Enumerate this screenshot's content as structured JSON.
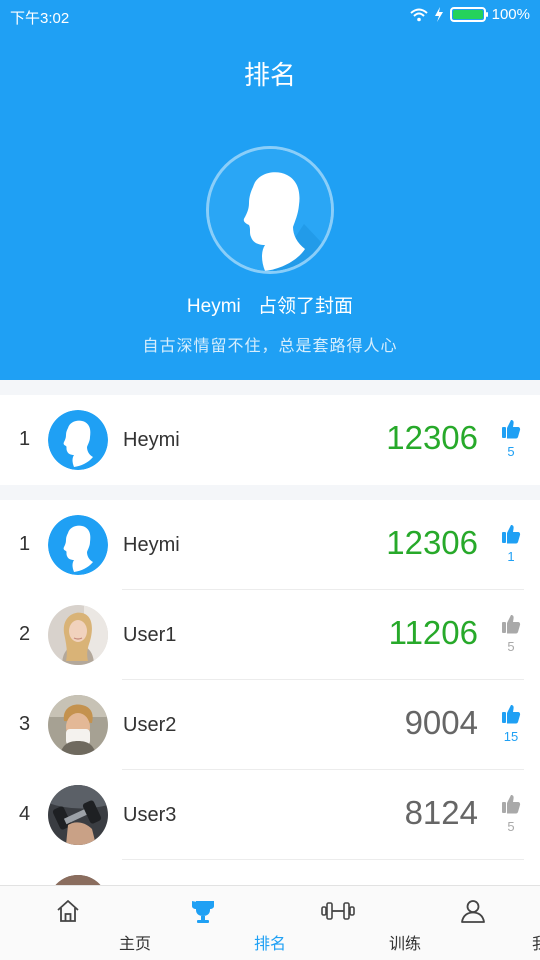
{
  "status_bar": {
    "time": "下午3:02",
    "battery": "100%",
    "battery_level": 1.0
  },
  "header": {
    "title": "排名",
    "cover_user": "Heymi",
    "cover_text": "占领了封面",
    "subtitle": "自古深情留不住，总是套路得人心"
  },
  "my_rank": {
    "rank": "1",
    "name": "Heymi",
    "score": "12306",
    "likes": "5",
    "liked": true,
    "avatar": "default-avatar"
  },
  "leaderboard": [
    {
      "rank": "1",
      "name": "Heymi",
      "score": "12306",
      "likes": "1",
      "liked": true,
      "score_color": "#27a92a",
      "avatar": "default-avatar"
    },
    {
      "rank": "2",
      "name": "User1",
      "score": "11206",
      "likes": "5",
      "liked": false,
      "score_color": "#27a92a",
      "avatar": "photo-blonde-woman"
    },
    {
      "rank": "3",
      "name": "User2",
      "score": "9004",
      "likes": "15",
      "liked": true,
      "score_color": "#666666",
      "avatar": "photo-man-tissue"
    },
    {
      "rank": "4",
      "name": "User3",
      "score": "8124",
      "likes": "5",
      "liked": false,
      "score_color": "#666666",
      "avatar": "photo-dumbbell"
    }
  ],
  "tabs": [
    {
      "label": "主页",
      "icon": "home-icon",
      "active": false
    },
    {
      "label": "排名",
      "icon": "trophy-icon",
      "active": true
    },
    {
      "label": "训练",
      "icon": "dumbbell-icon",
      "active": false
    },
    {
      "label": "我",
      "icon": "person-icon",
      "active": false
    }
  ],
  "colors": {
    "primary": "#1fa0f4",
    "score_high": "#27a92a",
    "score_normal": "#666666",
    "like_inactive": "#a9a9a9"
  }
}
